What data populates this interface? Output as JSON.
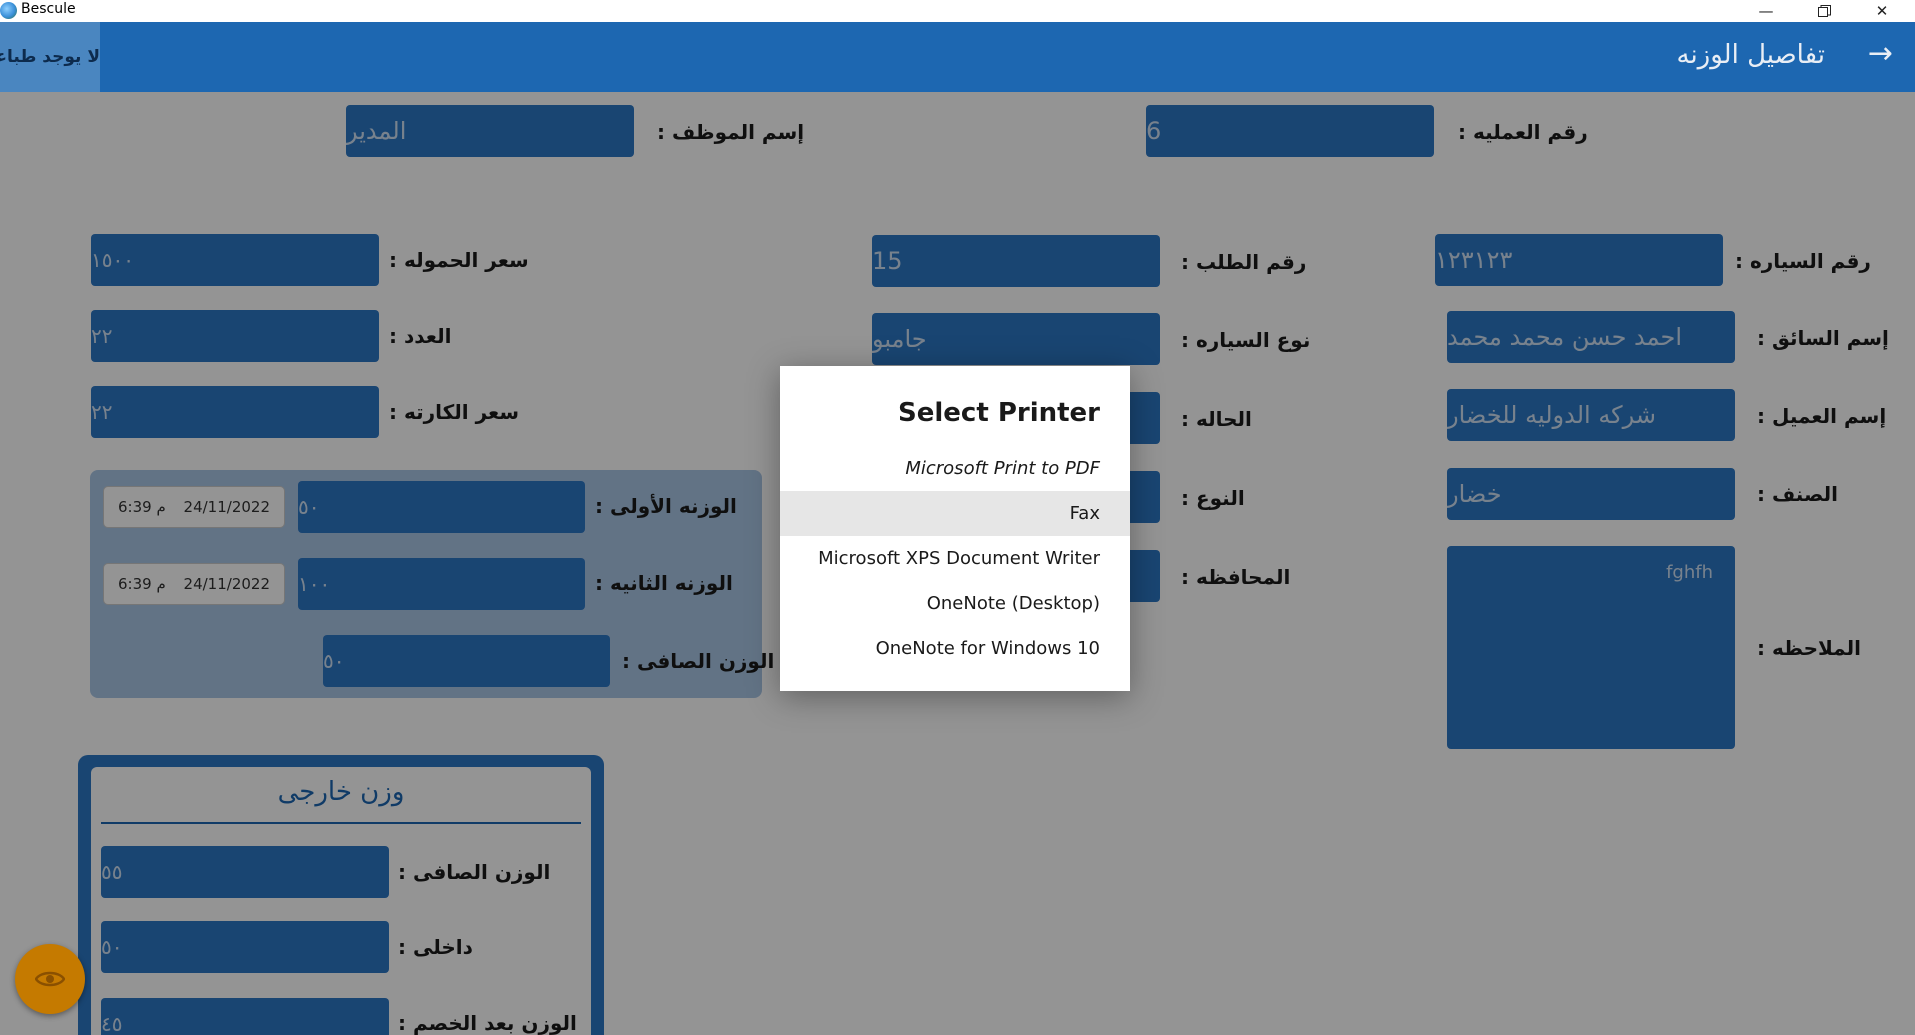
{
  "window": {
    "title": "Bescule",
    "controls": [
      "minimize",
      "maximize",
      "close"
    ]
  },
  "header": {
    "title": "تفاصيل الوزنه",
    "printer_status": "لا يوجد طباعة",
    "back_icon": "arrow-right-icon"
  },
  "top_fields": {
    "operation_no": {
      "label": "رقم العمليه :",
      "value": "6"
    },
    "employee_name": {
      "label": "إسم الموظف :",
      "value": "المدير"
    }
  },
  "right_column": {
    "car_no": {
      "label": "رقم السياره :",
      "value": "١٢٣١٢٣"
    },
    "driver_name": {
      "label": "إسم السائق :",
      "value": "احمد حسن محمد محمد"
    },
    "client_name": {
      "label": "إسم العميل :",
      "value": "شركه الدوليه للخضار"
    },
    "category": {
      "label": "الصنف :",
      "value": "خضار"
    },
    "notes": {
      "label": "الملاحظه :",
      "value": "fghfh"
    }
  },
  "middle_column": {
    "order_no": {
      "label": "رقم الطلب :",
      "value": "15"
    },
    "car_type": {
      "label": "نوع السياره :",
      "value": "جامبو"
    },
    "status": {
      "label": "الحاله :",
      "value": ""
    },
    "kind": {
      "label": "النوع :",
      "value": ""
    },
    "governorate": {
      "label": "المحافظه :",
      "value": ""
    }
  },
  "left_column": {
    "load_price": {
      "label": "سعر الحموله :",
      "value": "١٥٠٠"
    },
    "count": {
      "label": "العدد :",
      "value": "٢٢"
    },
    "card_price": {
      "label": "سعر الكارته :",
      "value": "٢٢"
    }
  },
  "weights": {
    "first": {
      "label": "الوزنه الأولى :",
      "value": "٥٠",
      "date": "24/11/2022",
      "time": "6:39 م"
    },
    "second": {
      "label": "الوزنه الثانيه :",
      "value": "١٠٠",
      "date": "24/11/2022",
      "time": "6:39 م"
    },
    "net": {
      "label": "الوزن الصافى :",
      "value": "٥٠"
    }
  },
  "external_weight": {
    "title": "وزن خارجى",
    "net": {
      "label": "الوزن الصافى :",
      "value": "٥٥"
    },
    "inner": {
      "label": "داخلى :",
      "value": "٥٠"
    },
    "after_discount": {
      "label": "الوزن بعد الخصم :",
      "value": "٤٥"
    }
  },
  "fab": {
    "icon": "eye-icon"
  },
  "dialog": {
    "title": "Select Printer",
    "printers": [
      "Microsoft Print to PDF",
      "Fax",
      "Microsoft XPS Document Writer",
      "OneNote (Desktop)",
      "OneNote for Windows 10"
    ]
  },
  "colors": {
    "header": "#1d67b1",
    "field": "#2c77c5",
    "fab": "#c57a00"
  }
}
